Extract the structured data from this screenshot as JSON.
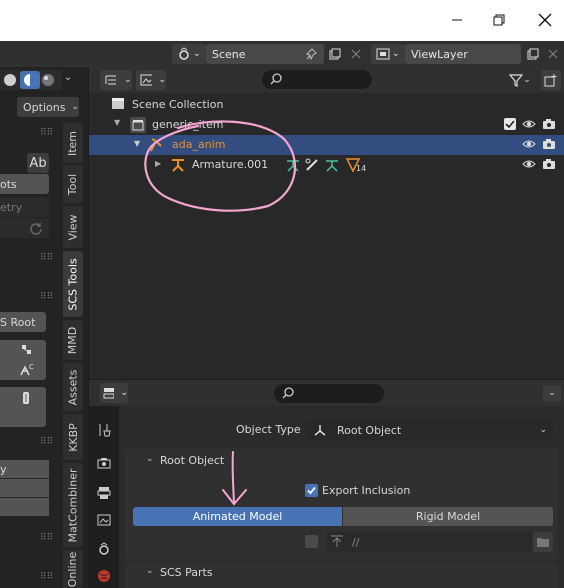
{
  "topbar": {
    "scene_label": "Scene",
    "viewlayer_label": "ViewLayer"
  },
  "left": {
    "options_label": "Options",
    "snippet_ots": "ots",
    "snippet_etry": "etry",
    "snippet_root": "S Root",
    "snippet_y": "y"
  },
  "tabs": [
    "Item",
    "Tool",
    "View",
    "SCS Tools",
    "MMD",
    "Assets",
    "KKBP",
    "MatCombiner",
    "Online"
  ],
  "outliner": {
    "scene_collection": "Scene Collection",
    "items": [
      {
        "label": "generic_item"
      },
      {
        "label": "ada_anim"
      },
      {
        "label": "Armature.001",
        "badge": "14"
      }
    ]
  },
  "properties": {
    "object_type_label": "Object Type",
    "object_type_value": "Root Object",
    "root_object_panel": "Root Object",
    "export_inclusion": "Export Inclusion",
    "animated_model": "Animated Model",
    "rigid_model": "Rigid Model",
    "path_value": "//",
    "scs_parts_panel": "SCS Parts"
  },
  "colors": {
    "selection": "#334d80",
    "accent_blue": "#4772b3",
    "orange": "#e8912c",
    "annotation": "#f4a6d0",
    "green_icon": "#48c2a2"
  }
}
